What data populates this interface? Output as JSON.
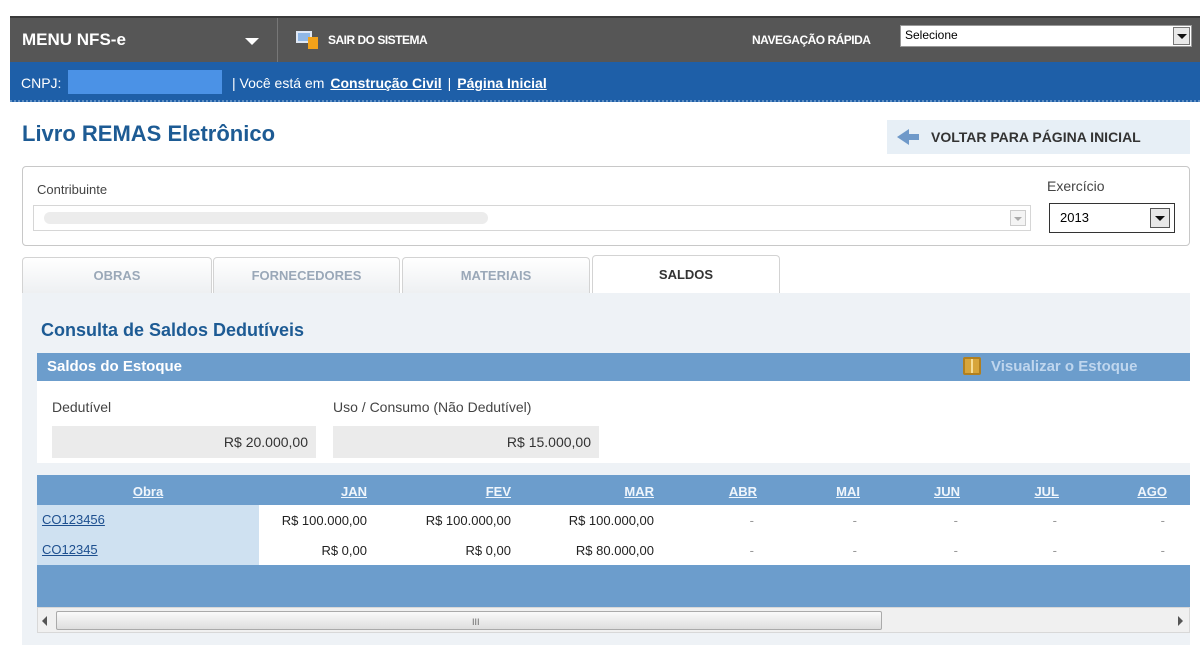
{
  "topbar": {
    "menu_label": "MENU NFS-e",
    "exit_label": "SAIR DO SISTEMA",
    "quick_nav_label": "NAVEGAÇÃO RÁPIDA",
    "quick_nav_value": "Selecione"
  },
  "infobar": {
    "cnpj_label": "CNPJ:",
    "location_prefix": "| Você está em",
    "link_section": "Construção Civil",
    "separator": "|",
    "link_home": "Página Inicial"
  },
  "page": {
    "title": "Livro REMAS Eletrônico",
    "back_label": "VOLTAR PARA PÁGINA INICIAL"
  },
  "filters": {
    "contrib_label": "Contribuinte",
    "exercicio_label": "Exercício",
    "exercicio_value": "2013"
  },
  "tabs": [
    "OBRAS",
    "FORNECEDORES",
    "MATERIAIS",
    "SALDOS"
  ],
  "active_tab": "SALDOS",
  "saldos": {
    "title": "Consulta de Saldos Dedutíveis",
    "stock_header": "Saldos do Estoque",
    "view_stock": "Visualizar o Estoque",
    "dedutivel_label": "Dedutível",
    "dedutivel_value": "R$ 20.000,00",
    "uso_label": "Uso / Consumo (Não Dedutível)",
    "uso_value": "R$ 15.000,00"
  },
  "table": {
    "headers": [
      "Obra",
      "JAN",
      "FEV",
      "MAR",
      "ABR",
      "MAI",
      "JUN",
      "JUL",
      "AGO"
    ],
    "rows": [
      [
        "CO123456",
        "R$ 100.000,00",
        "R$ 100.000,00",
        "R$ 100.000,00",
        "-",
        "-",
        "-",
        "-",
        "-"
      ],
      [
        "CO12345",
        "R$ 0,00",
        "R$ 0,00",
        "R$ 80.000,00",
        "-",
        "-",
        "-",
        "-",
        "-"
      ]
    ]
  },
  "scrollbar": {
    "grip": "III"
  },
  "colors": {
    "topbar": "#565656",
    "bluebar": "#1e5fa8",
    "title": "#1d5b94",
    "panel_header": "#6c9dcc"
  }
}
